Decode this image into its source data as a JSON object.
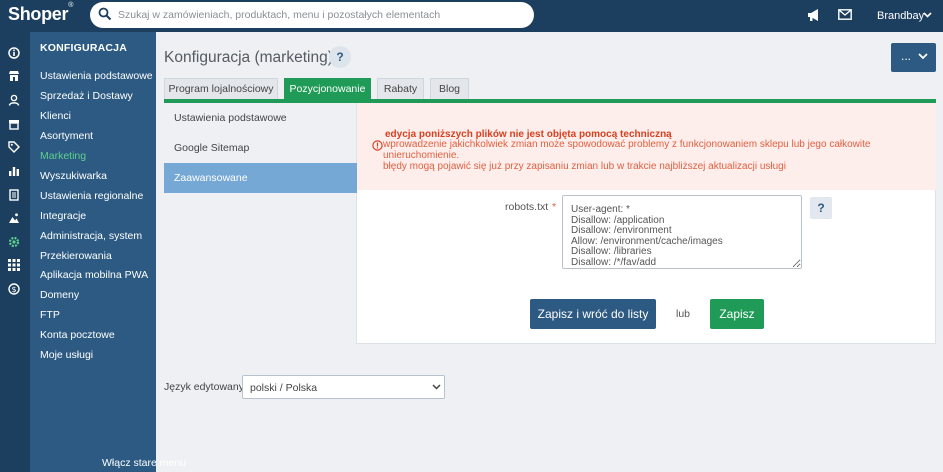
{
  "app": {
    "logo": "Shoper",
    "logo_mark": "®",
    "search_placeholder": "Szukaj w zamówieniach, produktach, menu i pozostałych elementach",
    "user": "Brandbay"
  },
  "rail_icons": [
    "info-icon",
    "store-icon",
    "users-icon",
    "box-icon",
    "tag-icon",
    "chart-icon",
    "document-icon",
    "image-icon",
    "gear-icon",
    "apps-icon",
    "dollar-icon"
  ],
  "sidebar": {
    "heading": "KONFIGURACJA",
    "items": [
      {
        "label": "Ustawienia podstawowe"
      },
      {
        "label": "Sprzedaż i Dostawy"
      },
      {
        "label": "Klienci"
      },
      {
        "label": "Asortyment"
      },
      {
        "label": "Marketing"
      },
      {
        "label": "Wyszukiwarka"
      },
      {
        "label": "Ustawienia regionalne"
      },
      {
        "label": "Integracje"
      },
      {
        "label": "Administracja, system"
      },
      {
        "label": "Przekierowania"
      },
      {
        "label": "Aplikacja mobilna PWA"
      },
      {
        "label": "Domeny"
      },
      {
        "label": "FTP"
      },
      {
        "label": "Konta pocztowe"
      },
      {
        "label": "Moje usługi"
      }
    ],
    "active_item": "Marketing",
    "footer": "Włącz stare menu"
  },
  "page": {
    "title": "Konfiguracja (marketing)",
    "help": "?",
    "more": "..."
  },
  "tabs": [
    {
      "label": "Program lojalnościowy"
    },
    {
      "label": "Pozycjonowanie"
    },
    {
      "label": "Rabaty"
    },
    {
      "label": "Blog"
    }
  ],
  "active_tab": "Pozycjonowanie",
  "subnav": [
    {
      "label": "Ustawienia podstawowe"
    },
    {
      "label": "Google Sitemap"
    },
    {
      "label": "Zaawansowane"
    }
  ],
  "active_subnav": "Zaawansowane",
  "alert": {
    "title": "edycja poniższych plików nie jest objęta pomocą techniczną",
    "line1": "wprowadzenie jakichkolwiek zmian może spowodować problemy z funkcjonowaniem sklepu lub jego całkowite unieruchomienie.",
    "line2": "błędy mogą pojawić się już przy zapisaniu zmian lub w trakcie najbliższej aktualizacji usługi"
  },
  "form": {
    "robots_label": "robots.txt",
    "required_mark": "*",
    "robots_value": "User-agent: *\nDisallow: /application\nDisallow: /environment\nAllow: /environment/cache/images\nDisallow: /libraries\nDisallow: /*/fav/add",
    "help": "?"
  },
  "actions": {
    "save_back": "Zapisz i wróć do listy",
    "or": "lub",
    "save": "Zapisz"
  },
  "language": {
    "label": "Język edytowany:",
    "selected": "polski / Polska"
  },
  "colors": {
    "topbar": "#1c3f5f",
    "sidebar": "#2c5a82",
    "accent_green": "#1f9a57",
    "active_subnav": "#76a8d6",
    "alert_text": "#e2603f"
  }
}
